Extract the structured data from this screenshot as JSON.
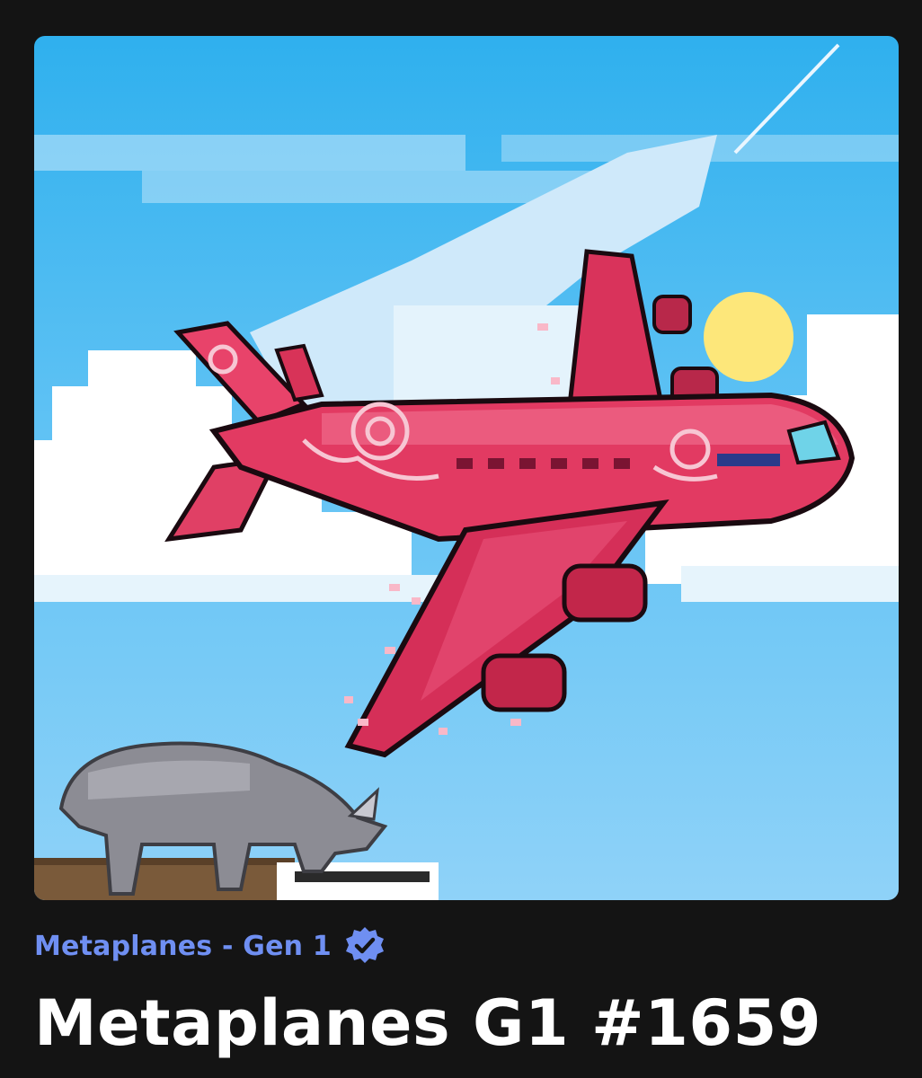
{
  "collection": {
    "name": "Metaplanes - Gen 1",
    "verified_icon": "verified-badge-icon"
  },
  "item": {
    "title": "Metaplanes G1 #1659"
  },
  "artwork": {
    "icon": "pixel-art-airplane-image"
  },
  "colors": {
    "background": "#141414",
    "collection_text": "#6f8ff2",
    "title_text": "#ffffff",
    "badge": "#6f8ff2"
  }
}
